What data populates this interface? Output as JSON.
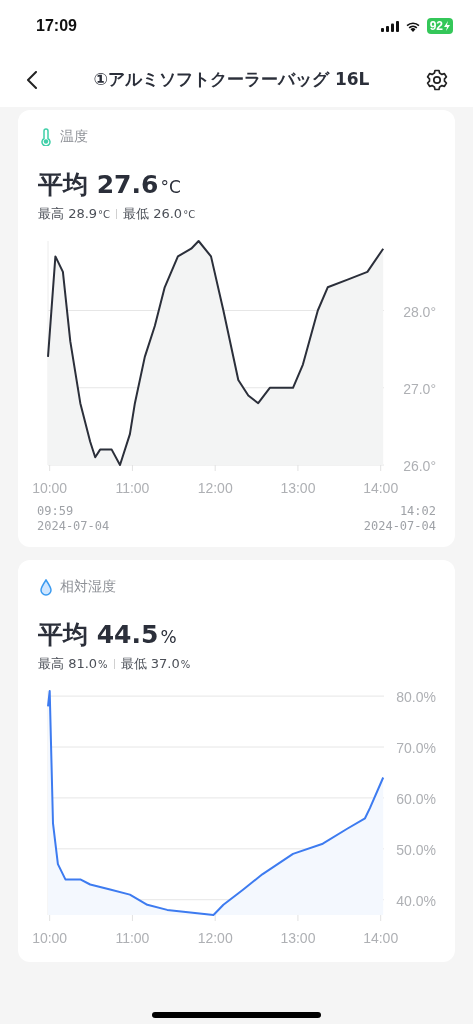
{
  "status_bar": {
    "time": "17:09",
    "battery": "92"
  },
  "nav": {
    "title": "①アルミソフトクーラーバッグ 16L"
  },
  "cards": [
    {
      "kind": "temperature",
      "title": "温度",
      "average": {
        "label": "平均",
        "value": "27.6",
        "unit": "°C"
      },
      "max": {
        "label": "最高",
        "value": "28.9",
        "unit": "°C"
      },
      "min": {
        "label": "最低",
        "value": "26.0",
        "unit": "°C"
      },
      "chart_data": {
        "type": "area",
        "x": [
          9.98,
          10.07,
          10.16,
          10.25,
          10.37,
          10.49,
          10.55,
          10.61,
          10.75,
          10.85,
          10.97,
          11.03,
          11.15,
          11.27,
          11.39,
          11.55,
          11.71,
          11.8,
          11.95,
          12.1,
          12.28,
          12.4,
          12.52,
          12.66,
          12.94,
          13.06,
          13.24,
          13.36,
          13.6,
          13.84,
          14.03
        ],
        "series": [
          {
            "color": "#2b2f3a",
            "values": [
              27.4,
              28.7,
              28.5,
              27.6,
              26.8,
              26.3,
              26.1,
              26.2,
              26.2,
              26.0,
              26.4,
              26.8,
              27.4,
              27.8,
              28.3,
              28.7,
              28.8,
              28.9,
              28.7,
              28.0,
              27.1,
              26.9,
              26.8,
              27.0,
              27.0,
              27.3,
              28.0,
              28.3,
              28.4,
              28.5,
              28.8
            ]
          }
        ],
        "xlim": [
          9.98,
          14.04
        ],
        "ylim": [
          26.0,
          28.9
        ],
        "grid": true,
        "xticks": [
          {
            "value": 10,
            "label": "10:00"
          },
          {
            "value": 11,
            "label": "11:00"
          },
          {
            "value": 12,
            "label": "12:00"
          },
          {
            "value": 13,
            "label": "13:00"
          },
          {
            "value": 14,
            "label": "14:00"
          }
        ],
        "yticks": [
          {
            "value": 26,
            "label": "26.0°"
          },
          {
            "value": 27,
            "label": "27.0°"
          },
          {
            "value": 28,
            "label": "28.0°"
          }
        ]
      },
      "range": {
        "start": {
          "time": "09:59",
          "date": "2024-07-04"
        },
        "end": {
          "time": "14:02",
          "date": "2024-07-04"
        }
      }
    },
    {
      "kind": "humidity",
      "title": "相対湿度",
      "average": {
        "label": "平均",
        "value": "44.5",
        "unit": "%"
      },
      "max": {
        "label": "最高",
        "value": "81.0",
        "unit": "%"
      },
      "min": {
        "label": "最低",
        "value": "37.0",
        "unit": "%"
      },
      "chart_data": {
        "type": "area",
        "x": [
          9.98,
          10.0,
          10.04,
          10.1,
          10.19,
          10.37,
          10.49,
          10.73,
          10.97,
          11.18,
          11.42,
          11.98,
          12.1,
          12.34,
          12.57,
          12.94,
          13.3,
          13.6,
          13.81,
          13.87,
          14.03
        ],
        "series": [
          {
            "color": "#3d7bf0",
            "values": [
              78,
              81,
              55,
              47,
              44,
              44,
              43,
              42,
              41,
              39,
              38,
              37,
              39,
              42,
              45,
              49,
              51,
              54,
              56,
              58,
              64
            ]
          }
        ],
        "xlim": [
          9.98,
          14.04
        ],
        "ylim": [
          37.0,
          81.0
        ],
        "grid": true,
        "xticks": [
          {
            "value": 10,
            "label": "10:00"
          },
          {
            "value": 11,
            "label": "11:00"
          },
          {
            "value": 12,
            "label": "12:00"
          },
          {
            "value": 13,
            "label": "13:00"
          },
          {
            "value": 14,
            "label": "14:00"
          }
        ],
        "yticks": [
          {
            "value": 40,
            "label": "40.0%"
          },
          {
            "value": 50,
            "label": "50.0%"
          },
          {
            "value": 60,
            "label": "60.0%"
          },
          {
            "value": 70,
            "label": "70.0%"
          },
          {
            "value": 80,
            "label": "80.0%"
          }
        ]
      }
    }
  ]
}
